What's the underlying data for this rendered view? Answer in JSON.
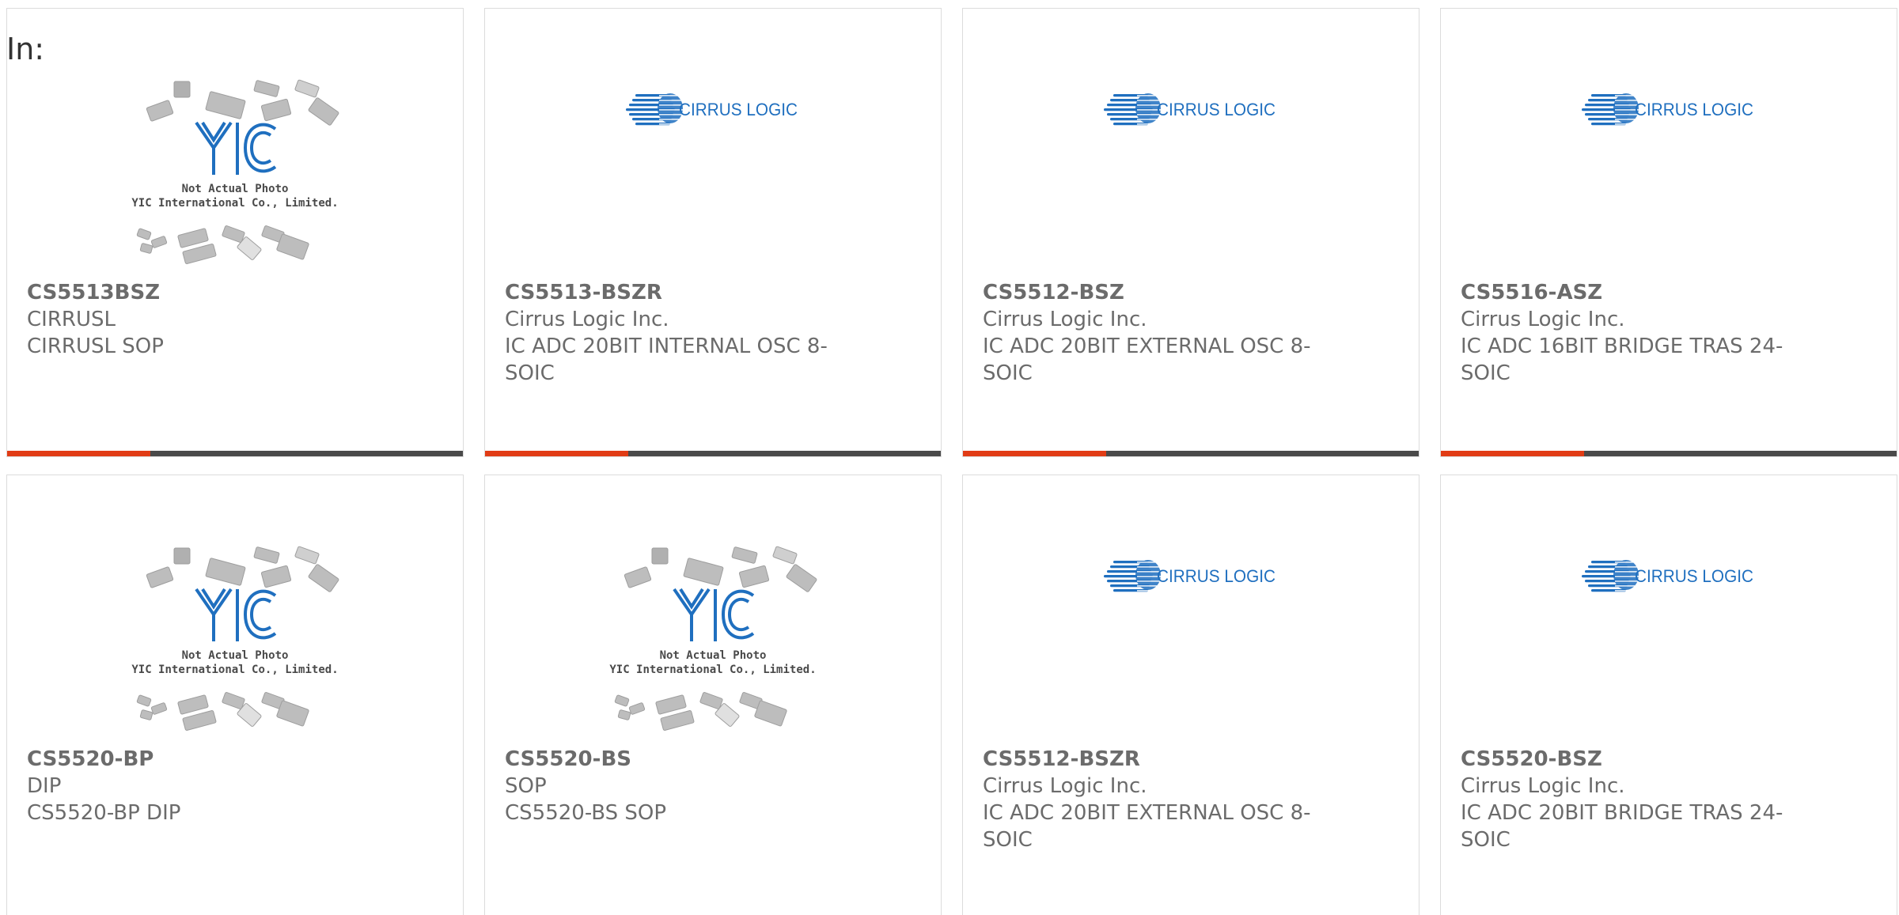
{
  "filter_label": "In:",
  "placeholder_caption": {
    "line1": "Not Actual Photo",
    "line2": "YIC International Co., Limited.",
    "logo": "YIC"
  },
  "brand_logo_text": "CIRRUS LOGIC",
  "colors": {
    "accent": "#e13c15",
    "bar": "#4a4a4a",
    "logo_blue": "#1f6fbf",
    "text": "#6b6b6b"
  },
  "products": [
    {
      "part": "CS5513BSZ",
      "maker": "CIRRUSL",
      "desc": "CIRRUSL SOP",
      "image": "placeholder"
    },
    {
      "part": "CS5513-BSZR",
      "maker": "Cirrus Logic Inc.",
      "desc": "IC ADC 20BIT INTERNAL OSC 8-SOIC",
      "image": "cirrus"
    },
    {
      "part": "CS5512-BSZ",
      "maker": "Cirrus Logic Inc.",
      "desc": "IC ADC 20BIT EXTERNAL OSC 8-SOIC",
      "image": "cirrus"
    },
    {
      "part": "CS5516-ASZ",
      "maker": "Cirrus Logic Inc.",
      "desc": "IC ADC 16BIT BRIDGE TRAS 24-SOIC",
      "image": "cirrus"
    },
    {
      "part": "CS5520-BP",
      "maker": "DIP",
      "desc": "CS5520-BP DIP",
      "image": "placeholder"
    },
    {
      "part": "CS5520-BS",
      "maker": "SOP",
      "desc": "CS5520-BS SOP",
      "image": "placeholder"
    },
    {
      "part": "CS5512-BSZR",
      "maker": "Cirrus Logic Inc.",
      "desc": "IC ADC 20BIT EXTERNAL OSC 8-SOIC",
      "image": "cirrus"
    },
    {
      "part": "CS5520-BSZ",
      "maker": "Cirrus Logic Inc.",
      "desc": "IC ADC 20BIT BRIDGE TRAS 24-SOIC",
      "image": "cirrus"
    }
  ]
}
